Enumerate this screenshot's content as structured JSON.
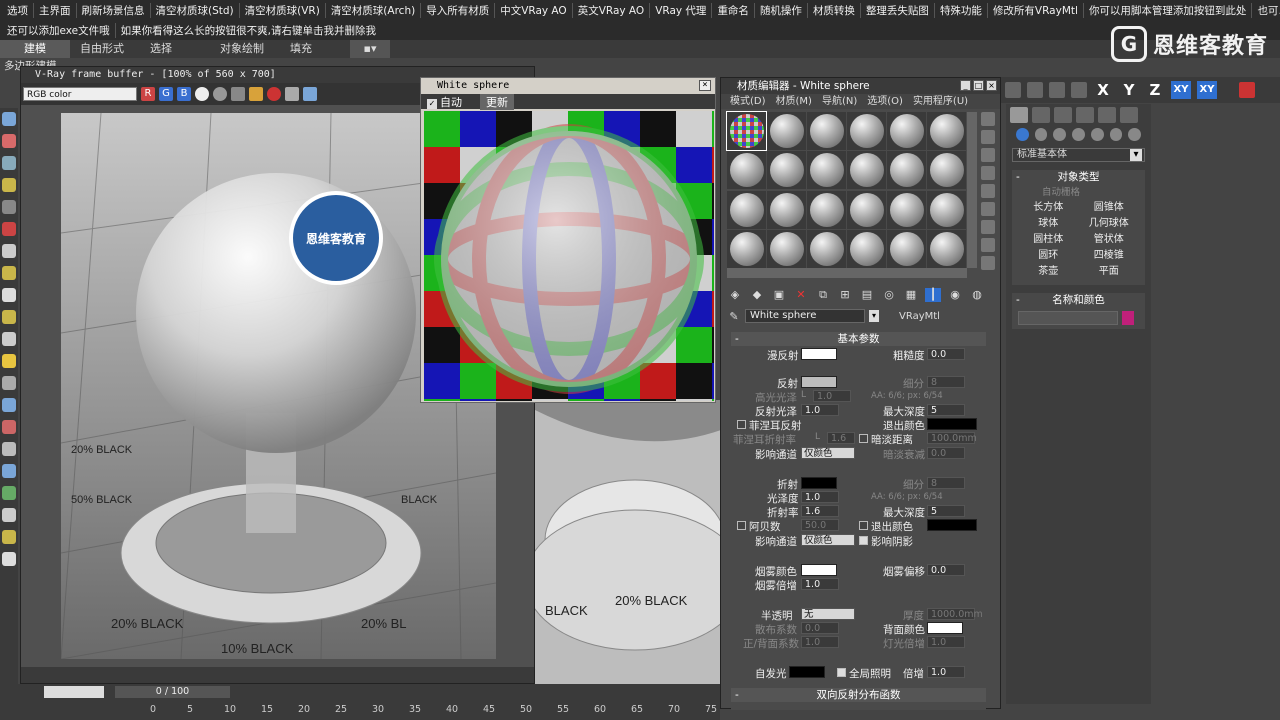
{
  "top_menu": {
    "row1": [
      "选项",
      "主界面",
      "刷新场景信息",
      "清空材质球(Std)",
      "清空材质球(VR)",
      "清空材质球(Arch)",
      "导入所有材质",
      "中文VRay AO",
      "英文VRay AO",
      "VRay 代理",
      "重命名",
      "随机操作",
      "材质转换",
      "整理丢失贴图",
      "特殊功能",
      "修改所有VRayMtl",
      "你可以用脚本管理添加按钮到此处",
      "也可以在选项里面直接添加脚本"
    ],
    "row2": [
      "还可以添加exe文件哦",
      "如果你看得这么长的按钮很不爽,请右键单击我并删除我"
    ]
  },
  "tabs": [
    {
      "label": "建模",
      "active": true
    },
    {
      "label": "自由形式"
    },
    {
      "label": "选择"
    },
    {
      "label": "对象绘制"
    },
    {
      "label": "填充"
    }
  ],
  "subtitle": "多边形建模",
  "logo": {
    "mark": "G",
    "text": "恩维客教育"
  },
  "frame_buffer": {
    "title": "V-Ray frame buffer - [100% of 560 x 700]",
    "channel": "RGB color",
    "channels": [
      "R",
      "G",
      "B"
    ],
    "label_logo": "恩维客教育",
    "sample_texts": [
      "10% BLACK",
      "20% BLACK",
      "50% BLACK",
      "BLACK",
      "20% BL"
    ]
  },
  "white_sphere": {
    "title": "White sphere",
    "auto": "自动",
    "update": "更新"
  },
  "material_editor": {
    "title": "材质编辑器 - White sphere",
    "menu": [
      "模式(D)",
      "材质(M)",
      "导航(N)",
      "选项(O)",
      "实用程序(U)"
    ],
    "material_name": "White sphere",
    "material_type": "VRayMtl",
    "sections": {
      "basic": "基本参数",
      "brdf": "双向反射分布函数"
    },
    "params": {
      "diffuse": "漫反射",
      "roughness": "粗糙度",
      "roughness_val": "0.0",
      "reflect": "反射",
      "subdivs": "细分",
      "subdivs_val": "8",
      "hilight_gloss": "高光光泽",
      "hilight_val": "1.0",
      "lock": "L",
      "aa_note": "AA: 6/6; px: 6/54",
      "refl_gloss": "反射光泽",
      "refl_gloss_val": "1.0",
      "max_depth": "最大深度",
      "max_depth_val": "5",
      "fresnel": "菲涅耳反射",
      "exit_color": "退出颜色",
      "fresnel_ior": "菲涅耳折射率",
      "fresnel_ior_val": "1.6",
      "dim_distance": "暗淡距离",
      "dim_distance_val": "100.0mm",
      "affect_channels": "影响通道",
      "color_only": "仅颜色",
      "dim_falloff": "暗淡衰减",
      "dim_falloff_val": "0.0",
      "refract": "折射",
      "refr_subdivs": "细分",
      "refr_subdivs_val": "8",
      "refr_gloss": "光泽度",
      "refr_gloss_val": "1.0",
      "refr_aa_note": "AA: 6/6; px: 6/54",
      "ior": "折射率",
      "ior_val": "1.6",
      "refr_max_depth": "最大深度",
      "refr_max_depth_val": "5",
      "abbe": "阿贝数",
      "abbe_val": "50.0",
      "refr_exit_color": "退出颜色",
      "refr_affect": "影响通道",
      "refr_color_only": "仅颜色",
      "affect_shadows": "影响阴影",
      "fog_color": "烟雾颜色",
      "fog_bias": "烟雾偏移",
      "fog_bias_val": "0.0",
      "fog_mult": "烟雾倍增",
      "fog_mult_val": "1.0",
      "translucency": "半透明",
      "translucency_val": "无",
      "thickness": "厚度",
      "thickness_val": "1000.0mm",
      "scatter": "散布系数",
      "scatter_val": "0.0",
      "back_color": "背面颜色",
      "fwd_back": "正/背面系数",
      "fwd_back_val": "1.0",
      "light_mult": "灯光倍增",
      "light_mult_val": "1.0",
      "self_illum": "自发光",
      "gi": "全局照明",
      "mult": "倍增",
      "mult_val": "1.0"
    }
  },
  "axes": [
    "X",
    "Y",
    "Z",
    "XY",
    "XY"
  ],
  "command_panel": {
    "category": "标准基本体",
    "object_type": "对象类型",
    "autogrid": "自动栅格",
    "objects": [
      "长方体",
      "圆锥体",
      "球体",
      "几何球体",
      "圆柱体",
      "管状体",
      "圆环",
      "四棱锥",
      "茶壶",
      "平面"
    ],
    "name_color": "名称和颜色"
  },
  "timeline": {
    "frame": "0 / 100",
    "ticks": [
      "0",
      "5",
      "10",
      "15",
      "20",
      "25",
      "30",
      "35",
      "40",
      "45",
      "50",
      "55",
      "60",
      "65",
      "70",
      "75"
    ]
  },
  "colors": {
    "accent": "#2f6fd0",
    "object_color": "#c0207a"
  }
}
